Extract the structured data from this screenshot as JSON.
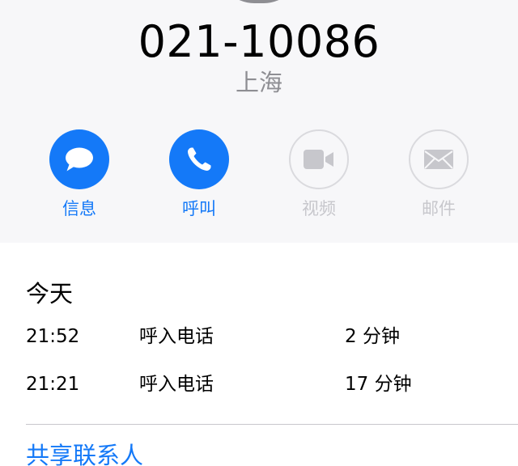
{
  "contact": {
    "phone_number": "021-10086",
    "location": "上海"
  },
  "actions": [
    {
      "label": "信息",
      "icon": "message-icon",
      "enabled": true
    },
    {
      "label": "呼叫",
      "icon": "phone-icon",
      "enabled": true
    },
    {
      "label": "视频",
      "icon": "video-camera-icon",
      "enabled": false
    },
    {
      "label": "邮件",
      "icon": "mail-icon",
      "enabled": false
    }
  ],
  "recents": {
    "section_title": "今天",
    "calls": [
      {
        "time": "21:52",
        "type": "呼入电话",
        "duration": "2 分钟"
      },
      {
        "time": "21:21",
        "type": "呼入电话",
        "duration": "17 分钟"
      }
    ]
  },
  "share_contact": {
    "label": "共享联系人"
  },
  "colors": {
    "accent": "#1479f8",
    "disabled": "#c7c7cc",
    "header_background": "#f7f7f9",
    "secondary_text": "#8e8e93"
  }
}
